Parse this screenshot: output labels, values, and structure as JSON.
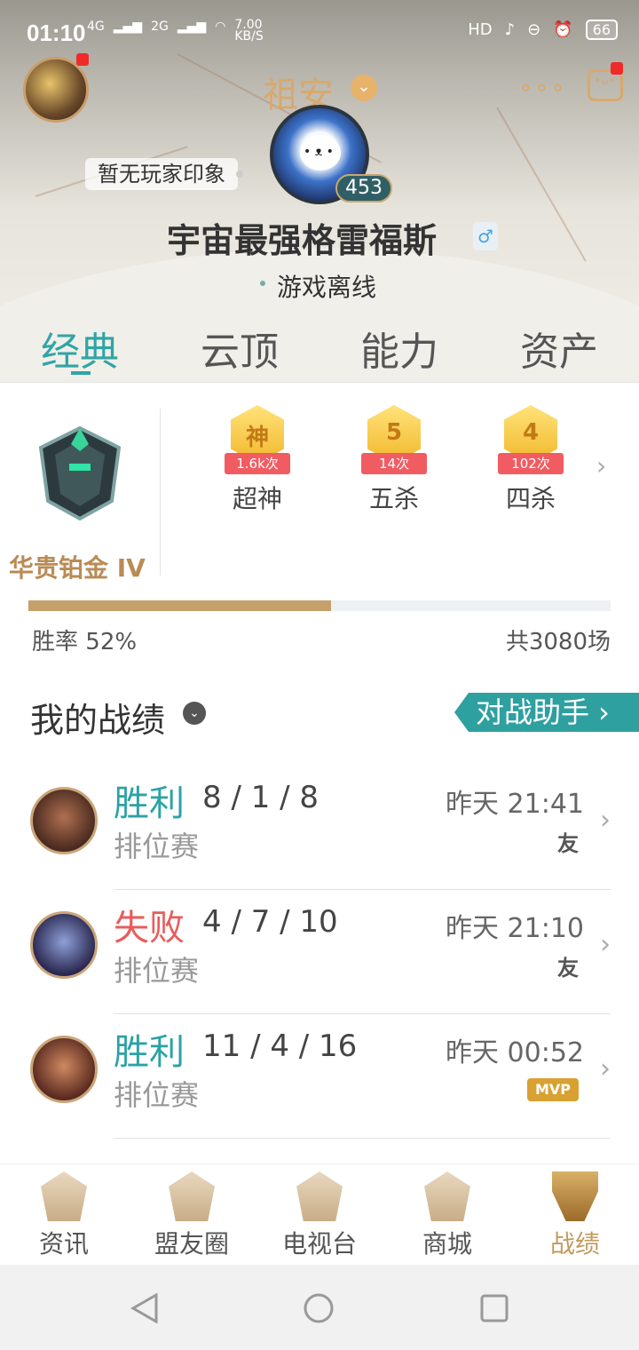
{
  "status_bar": {
    "time": "01:10",
    "net1": "4G",
    "net2": "2G",
    "speed_value": "7.00",
    "speed_unit": "KB/S",
    "hd": "HD",
    "battery": "66"
  },
  "header": {
    "server_name": "祖安",
    "impression": "暂无玩家印象",
    "level": "453",
    "player_name": "宇宙最强格雷福斯",
    "gender_symbol": "♂",
    "online_status": "游戏离线",
    "more_symbol": "∘∘∘"
  },
  "tabs": [
    {
      "label": "经典",
      "active": true
    },
    {
      "label": "云顶",
      "active": false
    },
    {
      "label": "能力",
      "active": false
    },
    {
      "label": "资产",
      "active": false
    }
  ],
  "rank": {
    "name": "华贵铂金 IV",
    "achievements": [
      {
        "medal": "神",
        "count": "1.6k次",
        "label": "超神"
      },
      {
        "medal": "5",
        "count": "14次",
        "label": "五杀"
      },
      {
        "medal": "4",
        "count": "102次",
        "label": "四杀"
      }
    ],
    "win_rate_label": "胜率",
    "win_rate_value": "52%",
    "win_rate_fraction": 0.52,
    "total": "共3080场"
  },
  "records": {
    "title": "我的战绩",
    "assist_button": "对战助手 ›",
    "matches": [
      {
        "result": "胜利",
        "win": true,
        "kda": "8 / 1 / 8",
        "mode": "排位赛",
        "time": "昨天 21:41",
        "tag": "友"
      },
      {
        "result": "失败",
        "win": false,
        "kda": "4 / 7 / 10",
        "mode": "排位赛",
        "time": "昨天 21:10",
        "tag": "友"
      },
      {
        "result": "胜利",
        "win": true,
        "kda": "11 / 4 / 16",
        "mode": "排位赛",
        "time": "昨天 00:52",
        "tag": "MVP"
      }
    ]
  },
  "bottom_nav": [
    {
      "label": "资讯",
      "active": false
    },
    {
      "label": "盟友圈",
      "active": false
    },
    {
      "label": "电视台",
      "active": false
    },
    {
      "label": "商城",
      "active": false
    },
    {
      "label": "战绩",
      "active": true
    }
  ],
  "colors": {
    "accent_teal": "#2fa5a5",
    "gold": "#c6a06a",
    "lose_red": "#ea5b5b"
  }
}
